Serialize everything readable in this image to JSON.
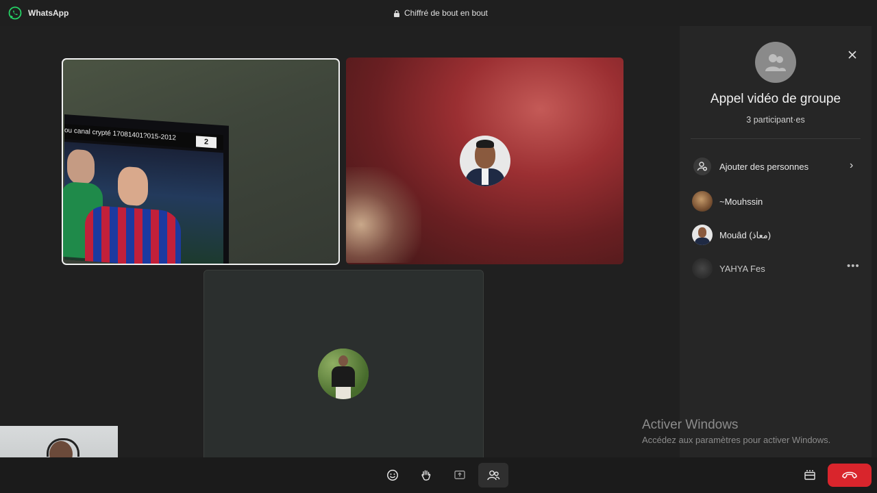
{
  "app": {
    "name": "WhatsApp",
    "encryption_label": "Chiffré de bout en bout"
  },
  "tv_overlay": {
    "banner_text": "ou canal crypté  17081401?015-2012",
    "channel": "2"
  },
  "panel": {
    "title": "Appel vidéo de groupe",
    "subtitle": "3 participant·es",
    "add_people_label": "Ajouter des personnes",
    "participants": [
      {
        "name": "~Mouhssin"
      },
      {
        "name": "Mouâd (معاذ)"
      },
      {
        "name": "YAHYA Fes"
      }
    ]
  },
  "watermark": {
    "title": "Activer Windows",
    "subtitle": "Accédez aux paramètres pour activer Windows."
  },
  "controls": {
    "icons": [
      "emoji-icon",
      "raise-hand-icon",
      "share-screen-icon",
      "participants-icon",
      "layout-icon",
      "end-call-icon"
    ]
  },
  "colors": {
    "end_call": "#d9252c",
    "whatsapp_green": "#25d366"
  }
}
